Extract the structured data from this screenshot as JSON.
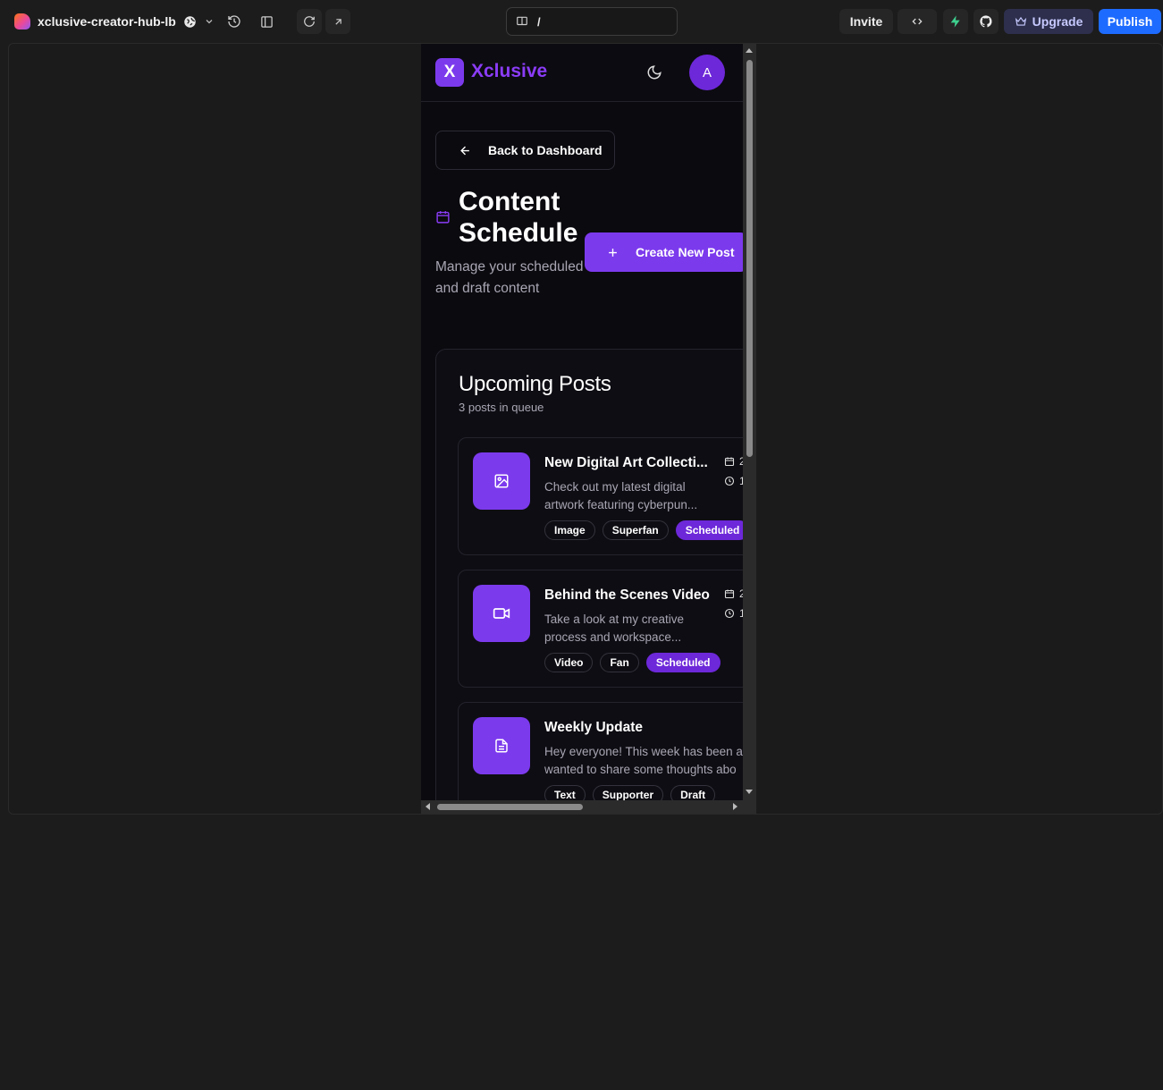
{
  "editor": {
    "project_name": "xclusive-creator-hub-lb",
    "url_path": "/",
    "invite_label": "Invite",
    "upgrade_label": "Upgrade",
    "publish_label": "Publish"
  },
  "app": {
    "logo_letter": "X",
    "brand": "Xclusive",
    "avatar_initial": "A",
    "back_label": "Back to Dashboard",
    "title": "Content Schedule",
    "subtitle": "Manage your scheduled and draft content",
    "create_label": "Create New Post",
    "accent": "#7c3aed"
  },
  "upcoming": {
    "title": "Upcoming Posts",
    "count_text": "3 posts in queue",
    "posts": [
      {
        "title": "New Digital Art Collecti...",
        "description": "Check out my latest digital artwork featuring cyberpun...",
        "date_partial": "2",
        "time_partial": "1",
        "type": "Image",
        "tier": "Superfan",
        "status": "Scheduled",
        "icon": "image-icon"
      },
      {
        "title": "Behind the Scenes Video",
        "description": "Take a look at my creative process and workspace...",
        "date_partial": "2",
        "time_partial": "1",
        "type": "Video",
        "tier": "Fan",
        "status": "Scheduled",
        "icon": "video-icon"
      },
      {
        "title": "Weekly Update",
        "description_line1": "Hey everyone! This week has been a",
        "description_line2": "wanted to share some thoughts abo",
        "type": "Text",
        "tier": "Supporter",
        "status": "Draft",
        "icon": "document-icon"
      }
    ]
  }
}
